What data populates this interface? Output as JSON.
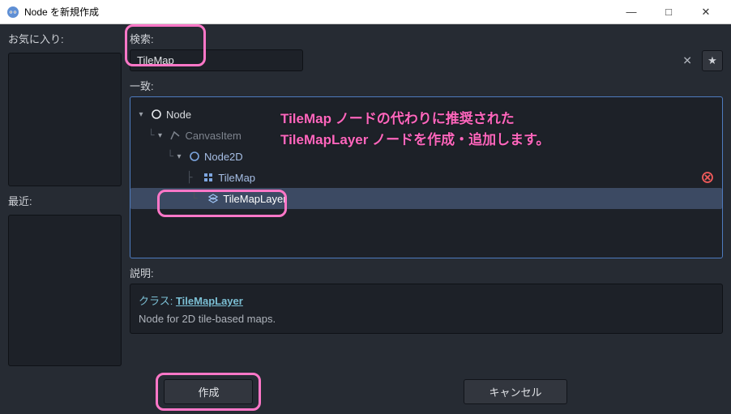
{
  "window": {
    "title": "Node を新規作成",
    "min_label": "—",
    "max_label": "□",
    "close_label": "✕"
  },
  "left": {
    "favorites_label": "お気に入り:",
    "recent_label": "最近:"
  },
  "search": {
    "label": "検索:",
    "value": "TileMap",
    "clear": "✕",
    "star": "★"
  },
  "matches_label": "一致:",
  "tree": {
    "node": "Node",
    "canvas_item": "CanvasItem",
    "node2d": "Node2D",
    "tilemap": "TileMap",
    "tilemaplayer": "TileMapLayer"
  },
  "annotation": {
    "line1": "TileMap ノードの代わりに推奨された",
    "line2": "TileMapLayer ノードを作成・追加します。"
  },
  "description": {
    "label": "説明:",
    "class_prefix": "クラス: ",
    "class_name": "TileMapLayer",
    "body": "Node for 2D tile-based maps."
  },
  "footer": {
    "create": "作成",
    "cancel": "キャンセル"
  }
}
